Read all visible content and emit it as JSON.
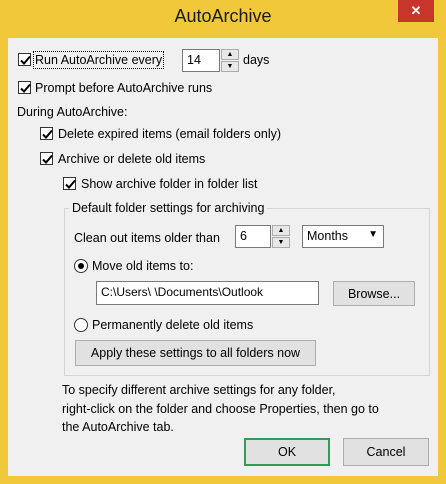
{
  "window": {
    "title": "AutoArchive",
    "close_glyph": "✕"
  },
  "run_every": {
    "prefix": "Run AutoArchive every",
    "value": "14",
    "suffix": "days",
    "checked": true
  },
  "prompt_before": {
    "label": "Prompt before AutoArchive runs",
    "checked": true
  },
  "during_label": "During AutoArchive:",
  "delete_expired": {
    "label": "Delete expired items (email folders only)",
    "checked": true
  },
  "archive_old": {
    "label": "Archive or delete old items",
    "checked": true
  },
  "show_folder": {
    "label": "Show archive folder in folder list",
    "checked": true
  },
  "group": {
    "title": "Default folder settings for archiving",
    "clean_label": "Clean out items older than",
    "clean_value": "6",
    "unit_selected": "Months",
    "move_label": "Move old items to:",
    "move_path": "C:\\Users\\            \\Documents\\Outlook",
    "browse_label": "Browse...",
    "permanent_label": "Permanently delete old items",
    "apply_label": "Apply these settings to all folders now"
  },
  "info_text": {
    "line1": "To specify different archive settings for any folder,",
    "line2": "right-click on the folder and choose Properties, then go to",
    "line3": "the AutoArchive tab."
  },
  "buttons": {
    "ok": "OK",
    "cancel": "Cancel"
  },
  "colors": {
    "frame": "#f0c83a",
    "client": "#f0f0f0",
    "close": "#c7352b",
    "default_border": "#2f9a5a"
  }
}
